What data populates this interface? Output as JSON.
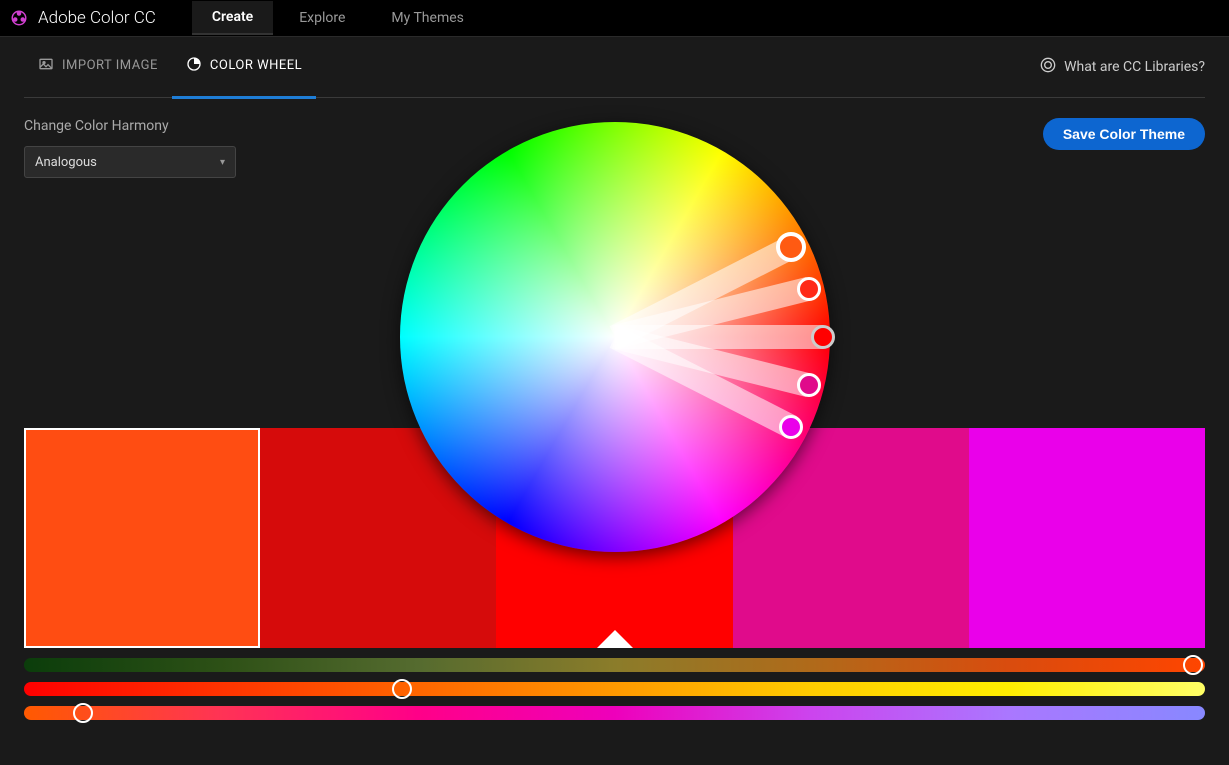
{
  "header": {
    "app_title": "Adobe Color CC",
    "nav": [
      "Create",
      "Explore",
      "My Themes"
    ],
    "active_nav": "Create"
  },
  "subtabs": {
    "import": "IMPORT IMAGE",
    "wheel": "COLOR WHEEL",
    "active": "COLOR WHEEL",
    "cc_link": "What are CC Libraries?"
  },
  "harmony": {
    "label": "Change Color Harmony",
    "selected": "Analogous"
  },
  "save_button": "Save Color Theme",
  "swatches": [
    {
      "color": "#ff4d12",
      "selected": true
    },
    {
      "color": "#d60b0b",
      "selected": false
    },
    {
      "color": "#ff0000",
      "selected": false,
      "base": true
    },
    {
      "color": "#e00b8b",
      "selected": false
    },
    {
      "color": "#ea00ea",
      "selected": false
    }
  ],
  "wheel_handles": [
    {
      "angle": -27,
      "radius": 0.92,
      "color": "#ff5a12",
      "big": true
    },
    {
      "angle": -14,
      "radius": 0.93,
      "color": "#ff2a18"
    },
    {
      "angle": 0,
      "radius": 0.97,
      "color": "#ff0000",
      "mid": true
    },
    {
      "angle": 14,
      "radius": 0.93,
      "color": "#e00b8b"
    },
    {
      "angle": 27,
      "radius": 0.92,
      "color": "#ea00ea"
    }
  ],
  "sliders": [
    {
      "class": "s1",
      "knob_pct": 99
    },
    {
      "class": "s2",
      "knob_pct": 32
    },
    {
      "class": "s3",
      "knob_pct": 5
    }
  ]
}
